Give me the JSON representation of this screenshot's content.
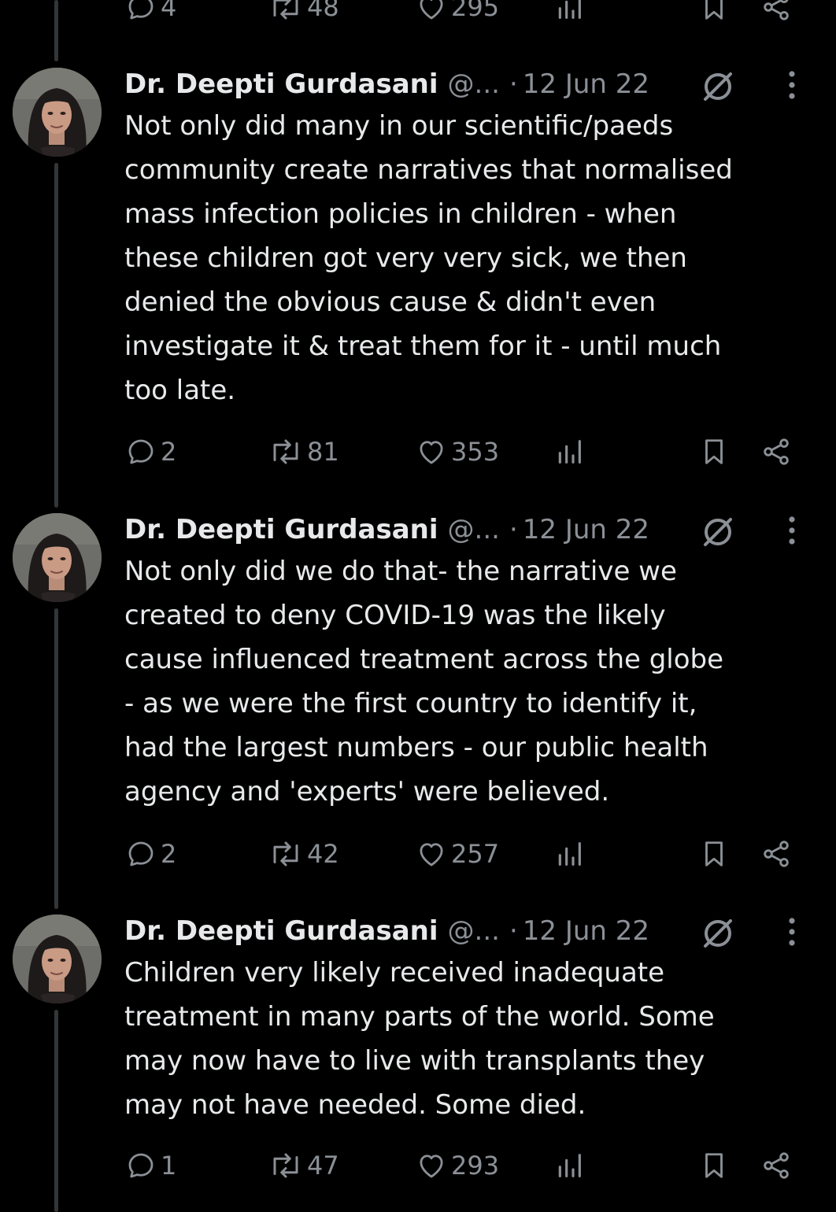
{
  "colors": {
    "background": "#000000",
    "text_primary": "#e7e9ea",
    "text_secondary": "#8b9096",
    "thread_line": "#333639"
  },
  "icons": {
    "reply": "speech-bubble-icon",
    "retweet": "retweet-arrows-icon",
    "like": "heart-icon",
    "views": "bar-chart-icon",
    "bookmark": "bookmark-icon",
    "share": "share-icon",
    "grok": "grok-slashed-circle-icon",
    "more": "vertical-ellipsis-icon"
  },
  "top_partial_actions": {
    "replies": "4",
    "retweets": "48",
    "likes": "295"
  },
  "tweets": [
    {
      "author_name": "Dr. Deepti Gurdasani",
      "handle": "@...",
      "separator": "·",
      "date": "12 Jun 22",
      "text": "Not only did many in our scientific/paeds\ncommunity create narratives that normalised\nmass infection policies in children - when\nthese children got very very sick, we then\ndenied the obvious cause & didn't even\ninvestigate it & treat them for it - until much\ntoo late.",
      "replies": "2",
      "retweets": "81",
      "likes": "353"
    },
    {
      "author_name": "Dr. Deepti Gurdasani",
      "handle": "@...",
      "separator": "·",
      "date": "12 Jun 22",
      "text": "Not only did we do that- the narrative we\ncreated to deny COVID-19 was the likely\ncause influenced treatment across the globe\n- as we were the first country to identify it,\nhad the largest numbers - our public health\nagency and 'experts' were believed.",
      "replies": "2",
      "retweets": "42",
      "likes": "257"
    },
    {
      "author_name": "Dr. Deepti Gurdasani",
      "handle": "@...",
      "separator": "·",
      "date": "12 Jun 22",
      "text": "Children very likely received inadequate\ntreatment in many parts of the world. Some\nmay now have to live with transplants they\nmay not have needed. Some died.",
      "replies": "1",
      "retweets": "47",
      "likes": "293"
    }
  ]
}
